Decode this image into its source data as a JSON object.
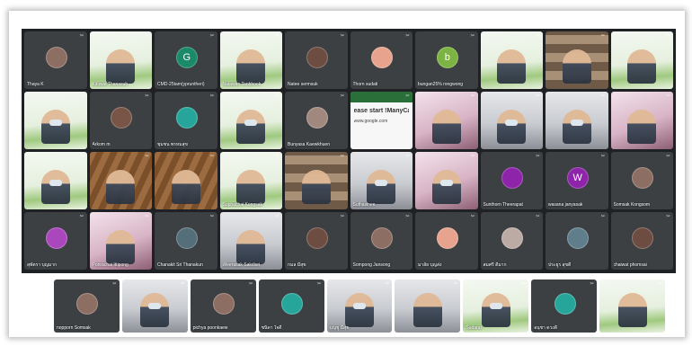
{
  "meeting": {
    "tiles": [
      {
        "name": "Thaya K",
        "kind": "avatar",
        "initial": "",
        "color": "#8d6e63"
      },
      {
        "name": "Kittiwat Thanasub",
        "kind": "video-green"
      },
      {
        "name": "CMD-25tam(ypruntheri)",
        "kind": "avatar",
        "initial": "G",
        "color": "#1b8a68"
      },
      {
        "name": "Natawan Tanbbook",
        "kind": "video-green"
      },
      {
        "name": "Natee sermsuk",
        "kind": "avatar",
        "initial": "",
        "color": "#6d4c41"
      },
      {
        "name": "Thorn sudati",
        "kind": "avatar",
        "initial": "",
        "color": "#e7a38d"
      },
      {
        "name": "bungan25% rongwong",
        "kind": "avatar",
        "initial": "b",
        "color": "#7cb342"
      },
      {
        "name": "",
        "kind": "video-green"
      },
      {
        "name": "",
        "kind": "video-shelf"
      },
      {
        "name": "",
        "kind": "video-green"
      },
      {
        "name": "",
        "kind": "video-green-mask"
      },
      {
        "name": "Arkom m",
        "kind": "avatar",
        "initial": "",
        "color": "#795548"
      },
      {
        "name": "ชุมชน พรหมสุข",
        "kind": "avatar",
        "initial": "",
        "color": "#26a69a"
      },
      {
        "name": "",
        "kind": "video-green-mask"
      },
      {
        "name": "Bunyasa Kaewkhuen",
        "kind": "avatar",
        "initial": "",
        "color": "#a1887f"
      },
      {
        "name": "",
        "kind": "slide",
        "title": "ease start !ManyCa",
        "sub": "www.google.com"
      },
      {
        "name": "",
        "kind": "video-pink"
      },
      {
        "name": "",
        "kind": "video-office-mask"
      },
      {
        "name": "",
        "kind": "video-office-mask"
      },
      {
        "name": "",
        "kind": "video-pink"
      },
      {
        "name": "",
        "kind": "video-green-mask"
      },
      {
        "name": "",
        "kind": "video-wood"
      },
      {
        "name": "",
        "kind": "video-wood"
      },
      {
        "name": "Suphachai Kongsak",
        "kind": "video-green"
      },
      {
        "name": "",
        "kind": "video-shelf"
      },
      {
        "name": "Suthasinee",
        "kind": "video-office-mask"
      },
      {
        "name": "",
        "kind": "video-pink-mask"
      },
      {
        "name": "Sunthorn Theerapat",
        "kind": "avatar",
        "initial": "",
        "color": "#8e24aa"
      },
      {
        "name": "wasana janyasak",
        "kind": "avatar",
        "initial": "W",
        "color": "#8e24aa"
      },
      {
        "name": "Somsak Kongsom",
        "kind": "avatar",
        "initial": "",
        "color": "#8d6e63"
      },
      {
        "name": "สุพัตรา บุญมาก",
        "kind": "avatar",
        "initial": "",
        "color": "#ab47bc"
      },
      {
        "name": "Ponrachai Ittipong",
        "kind": "video-pink"
      },
      {
        "name": "Chanakit Sri Thanakun",
        "kind": "avatar",
        "initial": "",
        "color": "#546e7a"
      },
      {
        "name": "Weerasak Sakdisri",
        "kind": "video-office"
      },
      {
        "name": "กมล มีสุข",
        "kind": "avatar",
        "initial": "",
        "color": "#6d4c41"
      },
      {
        "name": "Sompong Jansong",
        "kind": "avatar",
        "initial": "",
        "color": "#8d6e63"
      },
      {
        "name": "มาลัย บุญส่ง",
        "kind": "avatar",
        "initial": "",
        "color": "#e7a38d"
      },
      {
        "name": "สมศรี ดีมาก",
        "kind": "avatar",
        "initial": "",
        "color": "#bcaaa4"
      },
      {
        "name": "ประยูร สุขดี",
        "kind": "avatar",
        "initial": "",
        "color": "#607d8b"
      },
      {
        "name": "chaiwat phomsai",
        "kind": "avatar",
        "initial": "",
        "color": "#6d4c41"
      }
    ],
    "last_row": [
      {
        "name": "nopporn Somsak",
        "kind": "avatar",
        "initial": "",
        "color": "#8d6e63"
      },
      {
        "name": "",
        "kind": "video-office-mask"
      },
      {
        "name": "pichya poonkaew",
        "kind": "avatar",
        "initial": "",
        "color": "#8d6e63"
      },
      {
        "name": "ชนิดา ใจดี",
        "kind": "avatar",
        "initial": "",
        "color": "#26a69a"
      },
      {
        "name": "บุญชู มีสุข",
        "kind": "video-office-mask"
      },
      {
        "name": "",
        "kind": "video-office"
      },
      {
        "name": "Sudarat",
        "kind": "video-green-mask"
      },
      {
        "name": "อนุชา ดวงดี",
        "kind": "avatar",
        "initial": "",
        "color": "#26a69a"
      },
      {
        "name": "",
        "kind": "video-green"
      }
    ]
  }
}
